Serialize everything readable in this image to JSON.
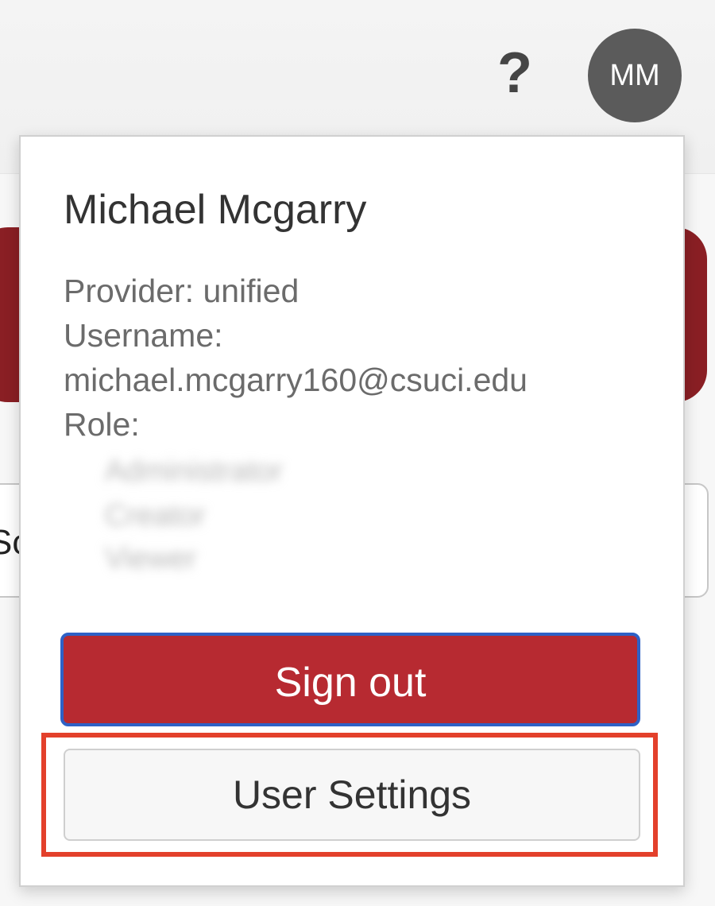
{
  "header": {
    "help_icon": "?",
    "avatar_initials": "MM"
  },
  "background": {
    "search_fragment": "Sc"
  },
  "user_menu": {
    "name": "Michael Mcgarry",
    "provider_line": "Provider: unified",
    "username_label": "Username:",
    "username_value": "michael.mcgarry160@csuci.edu",
    "role_label": "Role:",
    "roles": [
      "Administrator",
      "Creator",
      "Viewer"
    ],
    "sign_out_label": "Sign out",
    "user_settings_label": "User Settings"
  },
  "colors": {
    "brand_red": "#b72a31",
    "banner_red": "#8a1f24",
    "avatar_gray": "#5b5b5b",
    "focus_blue": "#2e61c6",
    "highlight_orange": "#e3402b"
  },
  "icons": {
    "help": "help-icon",
    "avatar": "avatar"
  }
}
